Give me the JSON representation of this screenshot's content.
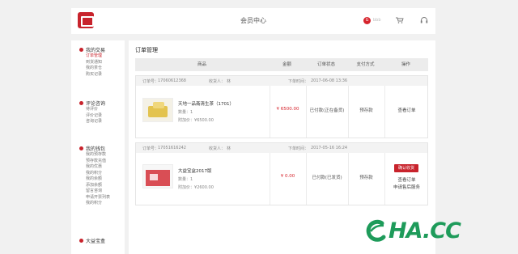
{
  "header": {
    "title": "会员中心",
    "user_badge": "G",
    "username": "bbb",
    "cart_icon": "cart-icon",
    "service_icon": "headset-icon",
    "logo_icon": "brand-logo"
  },
  "sidebar": {
    "sections": [
      {
        "title": "我的交易",
        "items": [
          "订单管理",
          "到货通知",
          "我的茶仓",
          "购买记录"
        ]
      },
      {
        "title": "评论咨询",
        "items": [
          "待评价",
          "评价记录",
          "咨询记录"
        ]
      },
      {
        "title": "我的钱包",
        "items": [
          "我的预存款",
          "预存款充值",
          "我的优惠",
          "我的积分",
          "我的余额",
          "添加余额",
          "留言咨询",
          "申请开票列表",
          "我的积分"
        ]
      },
      {
        "title": "大益宝盒",
        "items": []
      }
    ]
  },
  "main": {
    "title": "订单管理",
    "columns": [
      "商品",
      "金额",
      "订单状态",
      "支付方式",
      "操作"
    ],
    "orders": [
      {
        "order_label": "订单号：",
        "order_no": "17060612368",
        "receiver_label": "收货人：",
        "receiver": "林",
        "time_label": "下单时间：",
        "time": "2017-06-08 13:36",
        "product_name": "天地一品斋清生茶（1701）",
        "qty_label": "数量：",
        "qty": "1",
        "price_label": "附加价：",
        "price": "¥6500.00",
        "amount": "¥ 6500.00",
        "status": "已付款(正在备货)",
        "payment": "预存款",
        "actions": [
          "查看订单"
        ],
        "thumb": "tea"
      },
      {
        "order_label": "订单号：",
        "order_no": "17051616242",
        "receiver_label": "收货人：",
        "receiver": "林",
        "time_label": "下单时间：",
        "time": "2017-05-16 16:24",
        "product_name": "大益宝盒2017版",
        "qty_label": "数量：",
        "qty": "1",
        "price_label": "附加价：",
        "price": "¥2600.00",
        "amount": "¥ 0.00",
        "status": "已付款(已发货)",
        "payment": "预存款",
        "actions": [
          "查看订单",
          "申请售后服务"
        ],
        "confirm": "确认收货",
        "thumb": "box"
      }
    ]
  },
  "watermark": {
    "text": "HA.CC",
    "color": "#1e9b5a"
  },
  "colors": {
    "accent": "#c8232c",
    "price": "#d6232c"
  }
}
